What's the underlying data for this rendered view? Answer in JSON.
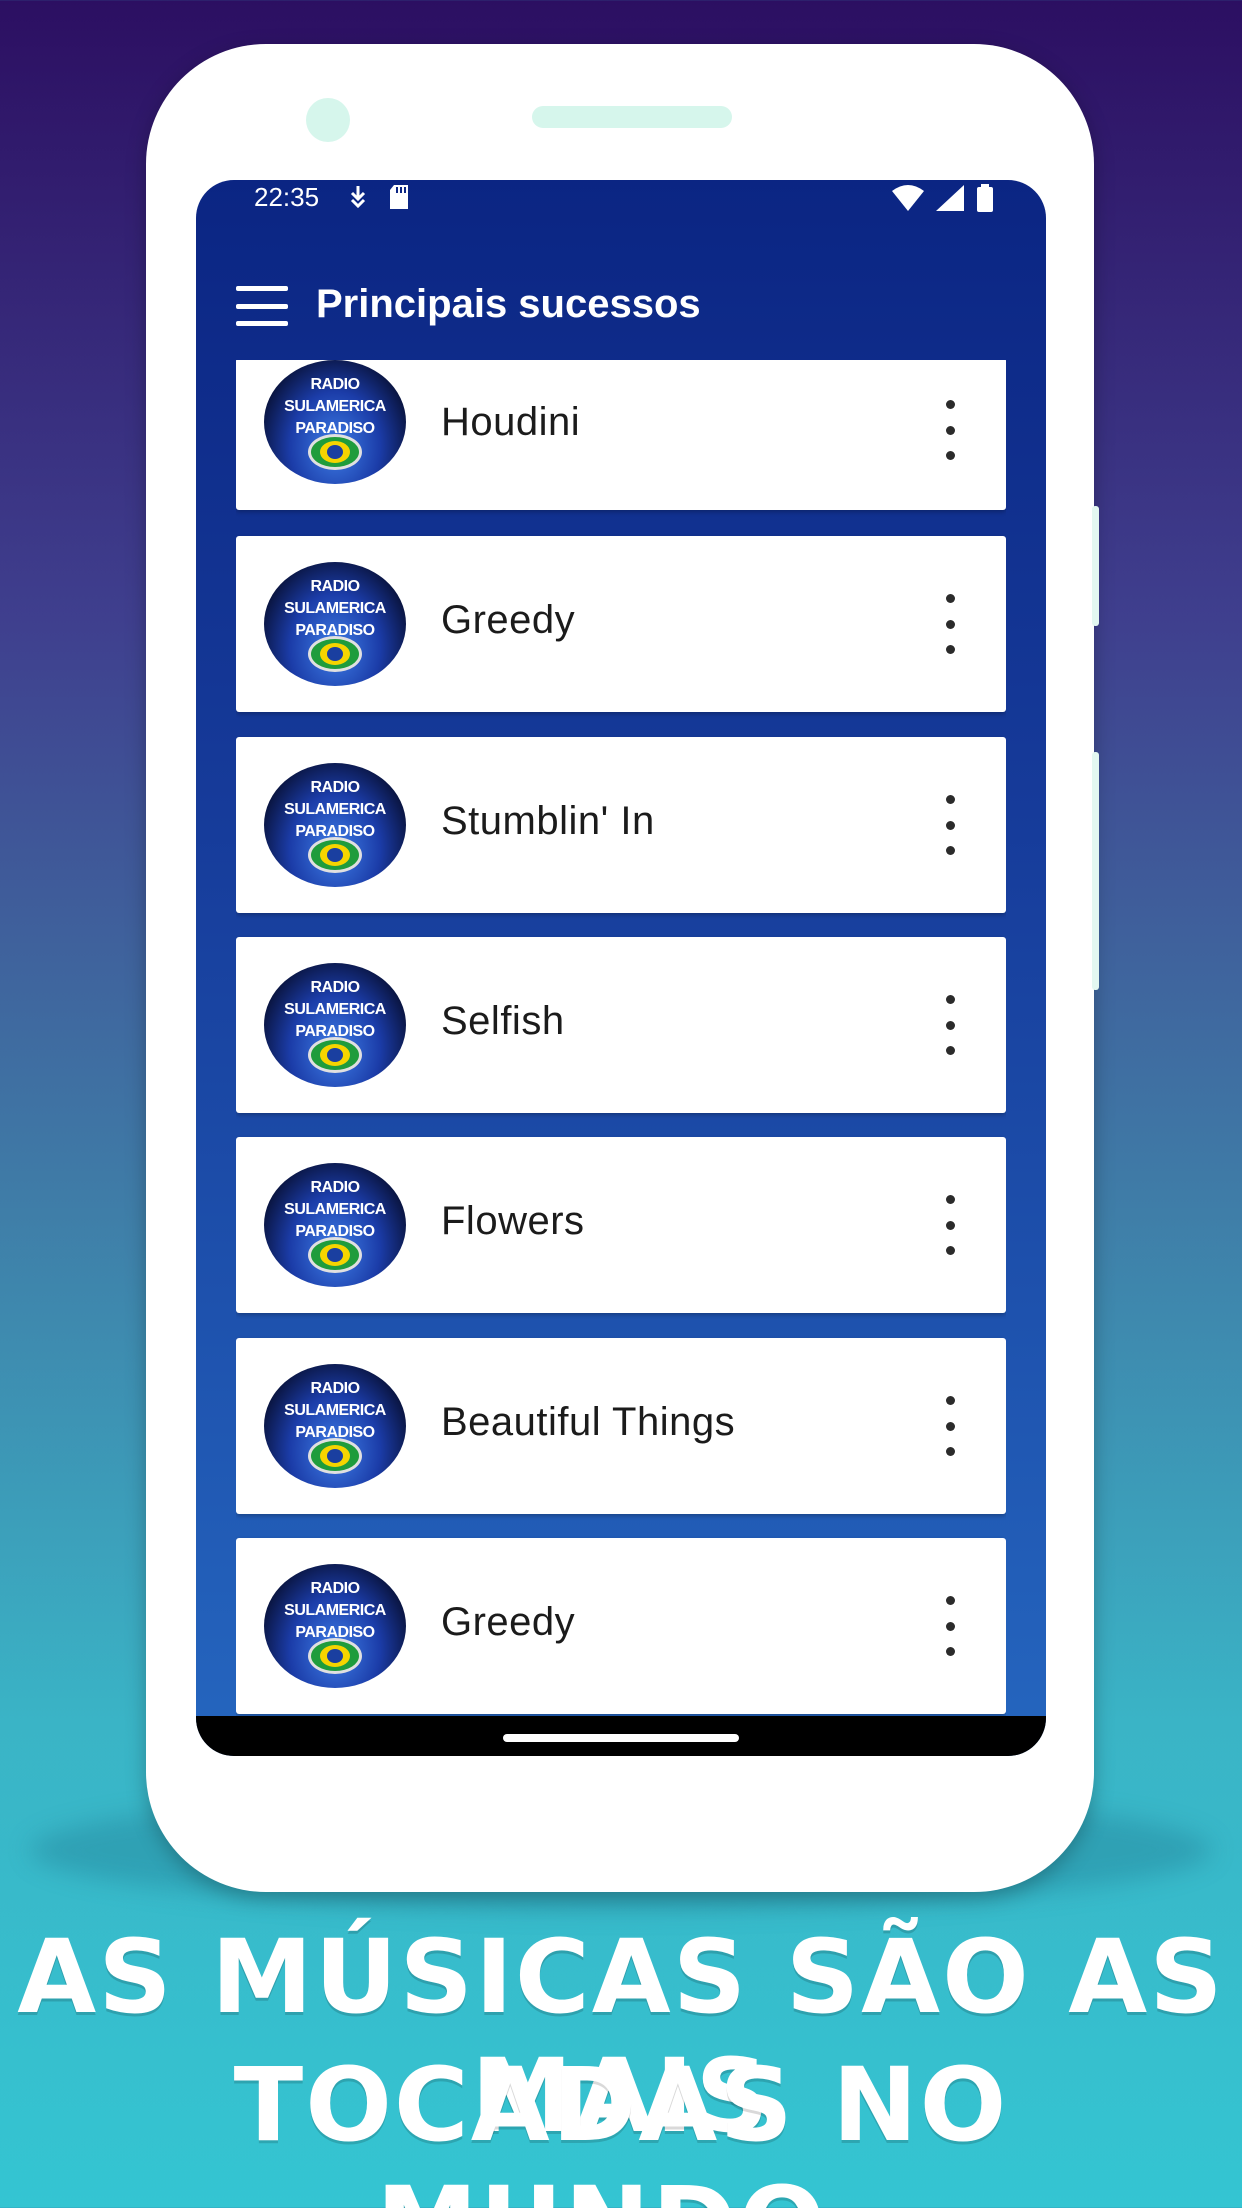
{
  "status_bar": {
    "time": "22:35",
    "icons_left": [
      "download-icon",
      "sd-card-icon"
    ],
    "icons_right": [
      "wifi-icon",
      "signal-icon",
      "battery-icon"
    ]
  },
  "app_bar": {
    "menu_icon": "hamburger-menu-icon",
    "title": "Principais sucessos"
  },
  "thumbnail_text": "RADIO SULAMERICA\nPARADISO",
  "songs": [
    {
      "title": "Houdini"
    },
    {
      "title": "Greedy"
    },
    {
      "title": "Stumblin' In"
    },
    {
      "title": "Selfish"
    },
    {
      "title": "Flowers"
    },
    {
      "title": "Beautiful Things"
    },
    {
      "title": "Greedy"
    }
  ],
  "caption": {
    "line1": "AS MÚSICAS SÃO AS MAIS",
    "line2": "TOCADAS NO MUNDO."
  },
  "colors": {
    "app_bar": "#0b2583",
    "card": "#ffffff",
    "phone_body": "#ffffff"
  }
}
